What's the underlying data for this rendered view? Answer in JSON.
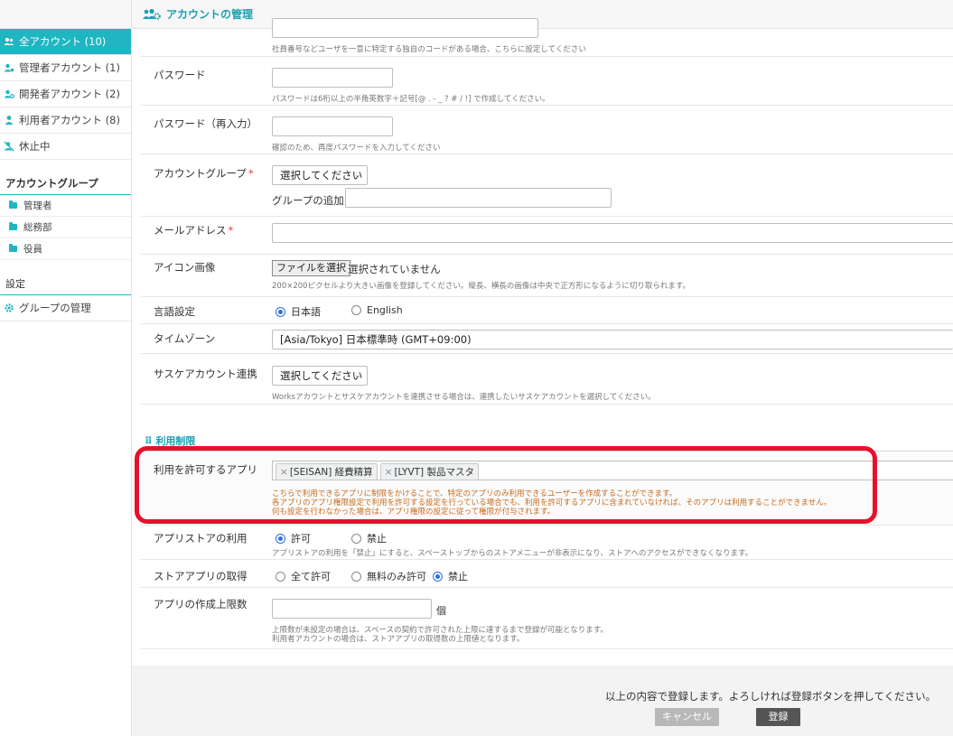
{
  "header": {
    "title": "アカウントの管理"
  },
  "sidebar": {
    "items": [
      {
        "label": "全アカウント (10)",
        "icon": "users-icon"
      },
      {
        "label": "管理者アカウント (1)",
        "icon": "admin-user-icon"
      },
      {
        "label": "開発者アカウント (2)",
        "icon": "developer-user-icon"
      },
      {
        "label": "利用者アカウント (8)",
        "icon": "user-icon"
      },
      {
        "label": "休止中",
        "icon": "suspended-user-icon"
      }
    ],
    "group_section": "アカウントグループ",
    "groups": [
      "管理者",
      "総務部",
      "役員"
    ],
    "settings_section": "設定",
    "settings_item": "グループの管理"
  },
  "form": {
    "code_note": "社員番号などユーザを一意に特定する独自のコードがある場合、こちらに設定してください",
    "password_label": "パスワード",
    "password_note": "パスワードは6桁以上の半角英数字＋記号[@ . - _ ? # / !] で作成してください。",
    "password_confirm_label": "パスワード（再入力）",
    "password_confirm_note": "確認のため、再度パスワードを入力してください",
    "group_label": "アカウントグループ",
    "group_select": "選択してください",
    "group_add_label": "グループの追加：",
    "email_label": "メールアドレス",
    "icon_label": "アイコン画像",
    "file_button": "ファイルを選択",
    "file_status": "選択されていません",
    "icon_note": "200×200ピクセルより大きい画像を登録してください。縦長、横長の画像は中央で正方形になるように切り取られます。",
    "language_label": "言語設定",
    "language_options": [
      "日本語",
      "English"
    ],
    "timezone_label": "タイムゾーン",
    "timezone_value": "[Asia/Tokyo] 日本標準時 (GMT+09:00)",
    "saske_label": "サスケアカウント連携",
    "saske_select": "選択してください",
    "saske_note": "Worksアカウントとサスケアカウントを連携させる場合は、連携したいサスケアカウントを選択してください。",
    "restriction_section": "利用制限",
    "allowed_apps_label": "利用を許可するアプリ",
    "allowed_apps": [
      "[SEISAN] 経費精算",
      "[LYVT] 製品マスタ"
    ],
    "allowed_apps_note1": "こちらで利用できるアプリに制限をかけることで、特定のアプリのみ利用できるユーザーを作成することができます。",
    "allowed_apps_note2": "各アプリのアプリ権限設定で利用を許可する設定を行っている場合でも、利用を許可するアプリに含まれていなければ、そのアプリは利用することができません。",
    "allowed_apps_note3": "何も設定を行わなかった場合は、アプリ権限の設定に従って権限が付与されます。",
    "appstore_label": "アプリストアの利用",
    "appstore_options": [
      "許可",
      "禁止"
    ],
    "appstore_note": "アプリストアの利用を「禁止」にすると、スペーストップからのストアメニューが非表示になり、ストアへのアクセスができなくなります。",
    "store_acquire_label": "ストアアプリの取得",
    "store_acquire_options": [
      "全て許可",
      "無料のみ許可",
      "禁止"
    ],
    "app_limit_label": "アプリの作成上限数",
    "app_limit_unit": "個",
    "app_limit_note1": "上限数が未設定の場合は、スペースの契約で許可された上限に達するまで登録が可能となります。",
    "app_limit_note2": "利用者アカウントの場合は、ストアアプリの取得数の上限値となります。"
  },
  "footer": {
    "message": "以上の内容で登録します。よろしければ登録ボタンを押してください。",
    "cancel_label": "キャンセル",
    "submit_label": "登録"
  },
  "colors": {
    "accent": "#1fb6c1",
    "highlight": "#e8102d"
  }
}
